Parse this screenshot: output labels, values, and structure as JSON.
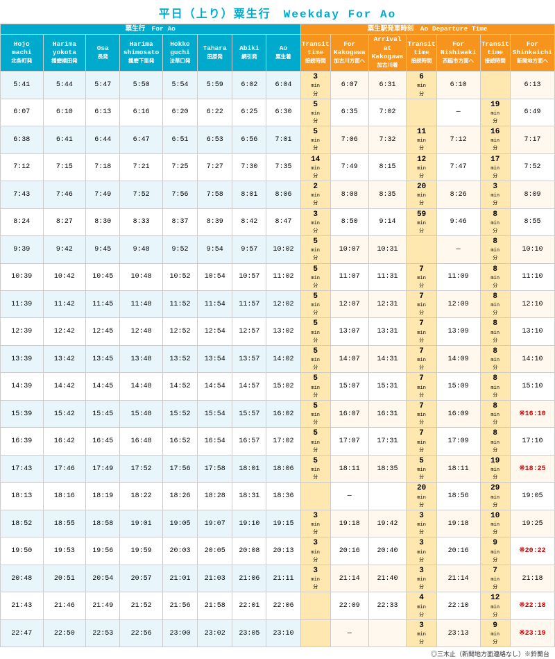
{
  "title": "平日（上り）粟生行　Weekday For Ao",
  "left_header": "粟生行　For Ao",
  "right_header": "粟生駅発車時刻　Ao Departure Time",
  "columns_left": [
    {
      "jp": "Hojo\nmachi",
      "sub": "北条町発"
    },
    {
      "jp": "Harima\nyokota",
      "sub": "播磨横田発"
    },
    {
      "jp": "Osa",
      "sub": "長発"
    },
    {
      "jp": "Harima\nshimosato",
      "sub": "播磨下里発"
    },
    {
      "jp": "Hokke\nguchi",
      "sub": "法華口発"
    },
    {
      "jp": "Tahara",
      "sub": "田原発"
    },
    {
      "jp": "Abiki",
      "sub": "網引発"
    },
    {
      "jp": "Ao",
      "sub": "粟生着"
    }
  ],
  "columns_right": [
    {
      "jp": "Transit\ntime",
      "sub": "接続時間"
    },
    {
      "jp": "For\nKakogawa",
      "sub": "加古川方面へ"
    },
    {
      "jp": "Arrival at\nKakogawa",
      "sub": "加古川着"
    },
    {
      "jp": "Transit\ntime",
      "sub": "接続時間"
    },
    {
      "jp": "For\nNishiwaki",
      "sub": "西脇市方面へ"
    },
    {
      "jp": "Transit\ntime",
      "sub": "接続時間"
    },
    {
      "jp": "For\nShinkaichi",
      "sub": "新開地方面へ"
    }
  ],
  "rows": [
    {
      "left": [
        "5:41",
        "5:44",
        "5:47",
        "5:50",
        "5:54",
        "5:59",
        "6:02",
        "6:04"
      ],
      "transit1": "3",
      "kago": "6:07",
      "arr_kago": "6:31",
      "transit2": "6",
      "nishi": "6:10",
      "transit3": "",
      "shin": "6:13"
    },
    {
      "left": [
        "6:07",
        "6:10",
        "6:13",
        "6:16",
        "6:20",
        "6:22",
        "6:25",
        "6:30"
      ],
      "transit1": "5",
      "kago": "6:35",
      "arr_kago": "7:02",
      "transit2": "",
      "nishi": "—",
      "transit3": "19",
      "shin": "6:49"
    },
    {
      "left": [
        "6:38",
        "6:41",
        "6:44",
        "6:47",
        "6:51",
        "6:53",
        "6:56",
        "7:01"
      ],
      "transit1": "5",
      "kago": "7:06",
      "arr_kago": "7:32",
      "transit2": "11",
      "nishi": "7:12",
      "transit3": "16",
      "shin": "7:17"
    },
    {
      "left": [
        "7:12",
        "7:15",
        "7:18",
        "7:21",
        "7:25",
        "7:27",
        "7:30",
        "7:35"
      ],
      "transit1": "14",
      "kago": "7:49",
      "arr_kago": "8:15",
      "transit2": "12",
      "nishi": "7:47",
      "transit3": "17",
      "shin": "7:52"
    },
    {
      "left": [
        "7:43",
        "7:46",
        "7:49",
        "7:52",
        "7:56",
        "7:58",
        "8:01",
        "8:06"
      ],
      "transit1": "2",
      "kago": "8:08",
      "arr_kago": "8:35",
      "transit2": "20",
      "nishi": "8:26",
      "transit3": "3",
      "shin": "8:09"
    },
    {
      "left": [
        "8:24",
        "8:27",
        "8:30",
        "8:33",
        "8:37",
        "8:39",
        "8:42",
        "8:47"
      ],
      "transit1": "3",
      "kago": "8:50",
      "arr_kago": "9:14",
      "transit2": "59",
      "nishi": "9:46",
      "transit3": "8",
      "shin": "8:55"
    },
    {
      "left": [
        "9:39",
        "9:42",
        "9:45",
        "9:48",
        "9:52",
        "9:54",
        "9:57",
        "10:02"
      ],
      "transit1": "5",
      "kago": "10:07",
      "arr_kago": "10:31",
      "transit2": "",
      "nishi": "—",
      "transit3": "8",
      "shin": "10:10"
    },
    {
      "left": [
        "10:39",
        "10:42",
        "10:45",
        "10:48",
        "10:52",
        "10:54",
        "10:57",
        "11:02"
      ],
      "transit1": "5",
      "kago": "11:07",
      "arr_kago": "11:31",
      "transit2": "7",
      "nishi": "11:09",
      "transit3": "8",
      "shin": "11:10"
    },
    {
      "left": [
        "11:39",
        "11:42",
        "11:45",
        "11:48",
        "11:52",
        "11:54",
        "11:57",
        "12:02"
      ],
      "transit1": "5",
      "kago": "12:07",
      "arr_kago": "12:31",
      "transit2": "7",
      "nishi": "12:09",
      "transit3": "8",
      "shin": "12:10"
    },
    {
      "left": [
        "12:39",
        "12:42",
        "12:45",
        "12:48",
        "12:52",
        "12:54",
        "12:57",
        "13:02"
      ],
      "transit1": "5",
      "kago": "13:07",
      "arr_kago": "13:31",
      "transit2": "7",
      "nishi": "13:09",
      "transit3": "8",
      "shin": "13:10"
    },
    {
      "left": [
        "13:39",
        "13:42",
        "13:45",
        "13:48",
        "13:52",
        "13:54",
        "13:57",
        "14:02"
      ],
      "transit1": "5",
      "kago": "14:07",
      "arr_kago": "14:31",
      "transit2": "7",
      "nishi": "14:09",
      "transit3": "8",
      "shin": "14:10"
    },
    {
      "left": [
        "14:39",
        "14:42",
        "14:45",
        "14:48",
        "14:52",
        "14:54",
        "14:57",
        "15:02"
      ],
      "transit1": "5",
      "kago": "15:07",
      "arr_kago": "15:31",
      "transit2": "7",
      "nishi": "15:09",
      "transit3": "8",
      "shin": "15:10"
    },
    {
      "left": [
        "15:39",
        "15:42",
        "15:45",
        "15:48",
        "15:52",
        "15:54",
        "15:57",
        "16:02"
      ],
      "transit1": "5",
      "kago": "16:07",
      "arr_kago": "16:31",
      "transit2": "7",
      "nishi": "16:09",
      "transit3": "8",
      "shin": "※16:10"
    },
    {
      "left": [
        "16:39",
        "16:42",
        "16:45",
        "16:48",
        "16:52",
        "16:54",
        "16:57",
        "17:02"
      ],
      "transit1": "5",
      "kago": "17:07",
      "arr_kago": "17:31",
      "transit2": "7",
      "nishi": "17:09",
      "transit3": "8",
      "shin": "17:10"
    },
    {
      "left": [
        "17:43",
        "17:46",
        "17:49",
        "17:52",
        "17:56",
        "17:58",
        "18:01",
        "18:06"
      ],
      "transit1": "5",
      "kago": "18:11",
      "arr_kago": "18:35",
      "transit2": "5",
      "nishi": "18:11",
      "transit3": "19",
      "shin": "※18:25"
    },
    {
      "left": [
        "18:13",
        "18:16",
        "18:19",
        "18:22",
        "18:26",
        "18:28",
        "18:31",
        "18:36"
      ],
      "transit1": "",
      "kago": "—",
      "arr_kago": "",
      "transit2": "20",
      "nishi": "18:56",
      "transit3": "29",
      "shin": "19:05"
    },
    {
      "left": [
        "18:52",
        "18:55",
        "18:58",
        "19:01",
        "19:05",
        "19:07",
        "19:10",
        "19:15"
      ],
      "transit1": "3",
      "kago": "19:18",
      "arr_kago": "19:42",
      "transit2": "3",
      "nishi": "19:18",
      "transit3": "10",
      "shin": "19:25"
    },
    {
      "left": [
        "19:50",
        "19:53",
        "19:56",
        "19:59",
        "20:03",
        "20:05",
        "20:08",
        "20:13"
      ],
      "transit1": "3",
      "kago": "20:16",
      "arr_kago": "20:40",
      "transit2": "3",
      "nishi": "20:16",
      "transit3": "9",
      "shin": "※20:22"
    },
    {
      "left": [
        "20:48",
        "20:51",
        "20:54",
        "20:57",
        "21:01",
        "21:03",
        "21:06",
        "21:11"
      ],
      "transit1": "3",
      "kago": "21:14",
      "arr_kago": "21:40",
      "transit2": "3",
      "nishi": "21:14",
      "transit3": "7",
      "shin": "21:18"
    },
    {
      "left": [
        "21:43",
        "21:46",
        "21:49",
        "21:52",
        "21:56",
        "21:58",
        "22:01",
        "22:06"
      ],
      "transit1": "",
      "kago": "22:09",
      "arr_kago": "22:33",
      "transit2": "4",
      "nishi": "22:10",
      "transit3": "12",
      "shin": "※22:18"
    },
    {
      "left": [
        "22:47",
        "22:50",
        "22:53",
        "22:56",
        "23:00",
        "23:02",
        "23:05",
        "23:10"
      ],
      "transit1": "",
      "kago": "—",
      "arr_kago": "",
      "transit2": "3",
      "nishi": "23:13",
      "transit3": "9",
      "shin": "※23:19"
    }
  ],
  "footer": "◎三木止（新聞地方面連絡なし）※鈴蘭台"
}
